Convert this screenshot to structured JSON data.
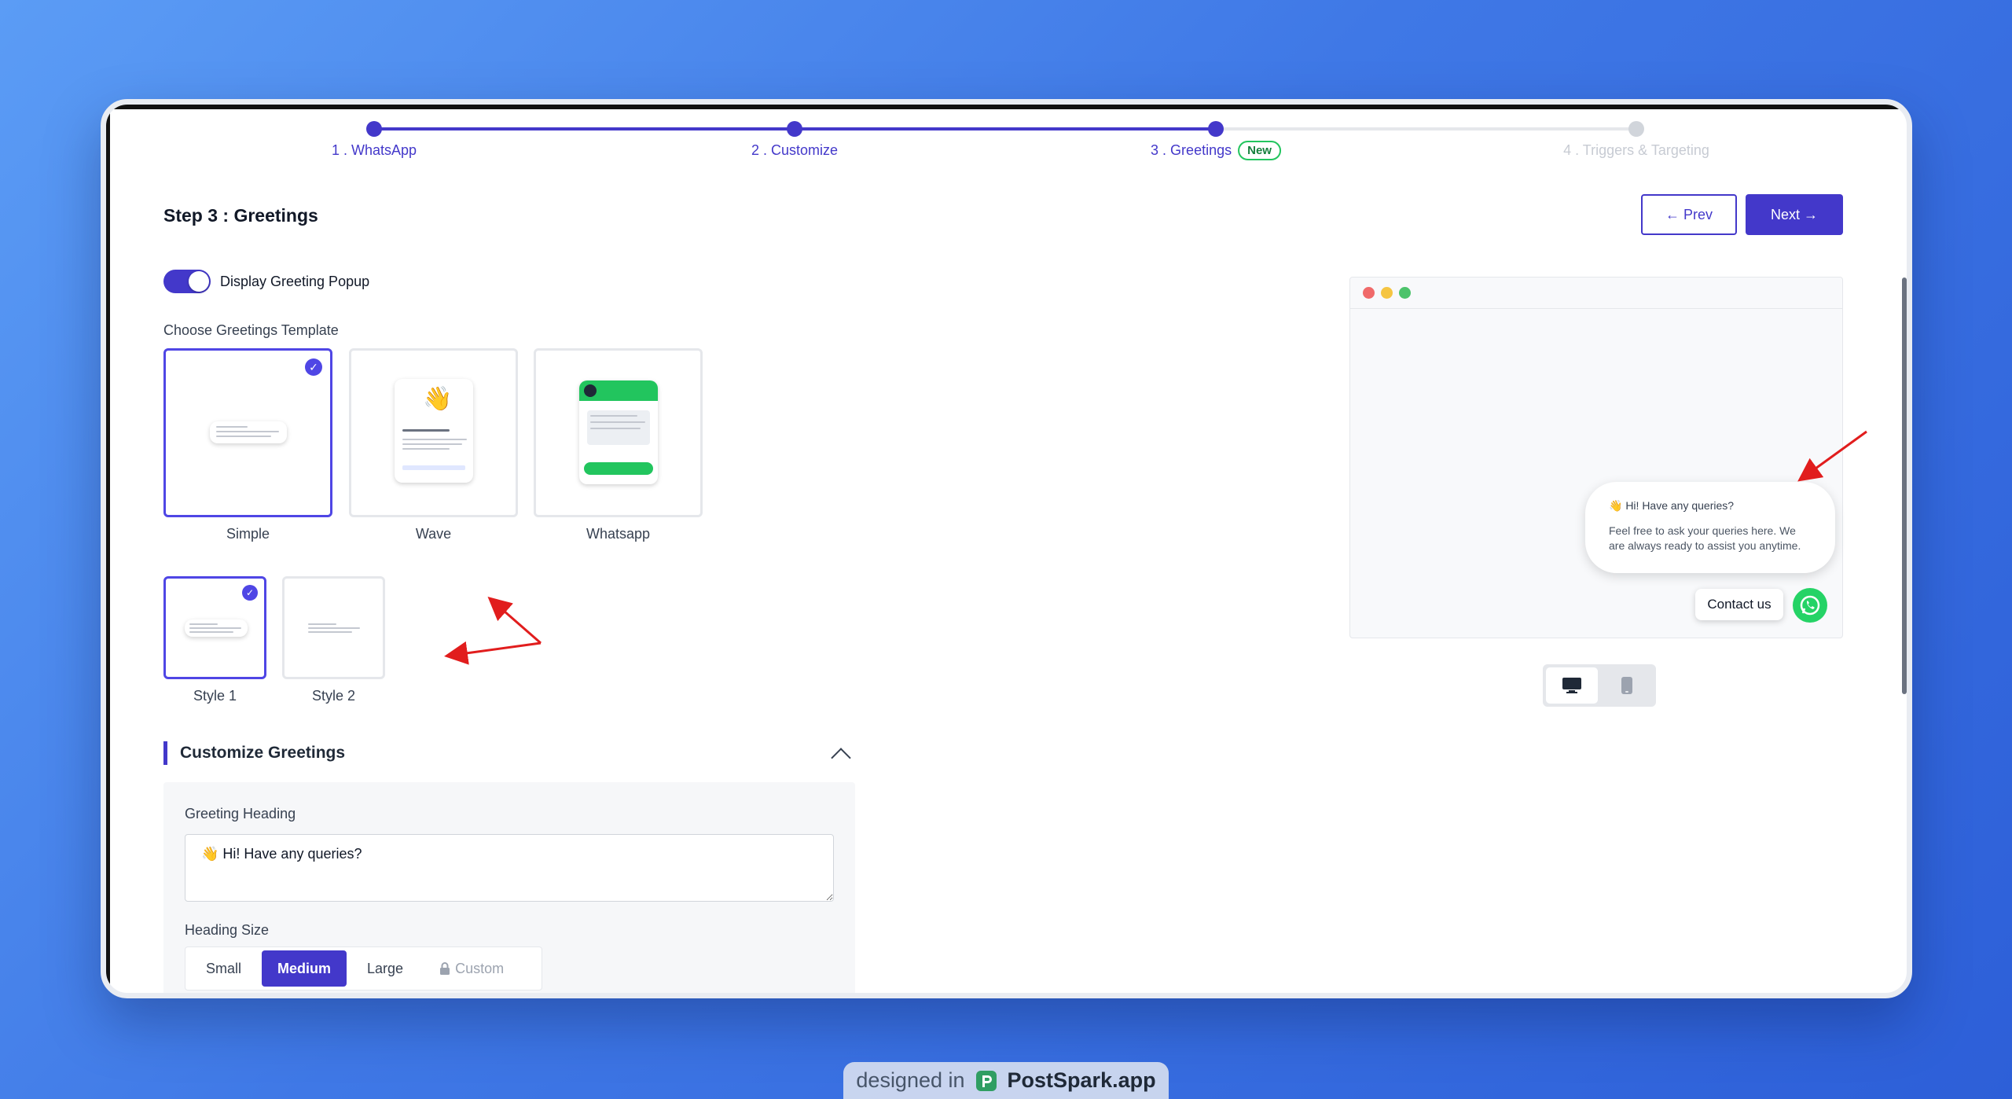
{
  "stepper": {
    "steps": [
      {
        "label": "1 . WhatsApp",
        "state": "done"
      },
      {
        "label": "2 . Customize",
        "state": "done"
      },
      {
        "label": "3 . Greetings",
        "state": "current",
        "badge": "New"
      },
      {
        "label": "4 . Triggers & Targeting",
        "state": "todo"
      }
    ]
  },
  "header": {
    "title": "Step 3 : Greetings",
    "prev_label": "← Prev",
    "next_label": "Next →"
  },
  "toggle": {
    "label": "Display Greeting Popup",
    "on": true
  },
  "templates": {
    "label": "Choose Greetings Template",
    "items": [
      {
        "name": "Simple",
        "selected": true
      },
      {
        "name": "Wave",
        "selected": false
      },
      {
        "name": "Whatsapp",
        "selected": false
      }
    ]
  },
  "styles": {
    "items": [
      {
        "name": "Style 1",
        "selected": true
      },
      {
        "name": "Style 2",
        "selected": false
      }
    ]
  },
  "customize": {
    "title": "Customize Greetings",
    "heading_label": "Greeting Heading",
    "heading_value": "👋 Hi! Have any queries?",
    "size_label": "Heading Size",
    "sizes": [
      "Small",
      "Medium",
      "Large",
      "Custom"
    ],
    "active_size": "Medium"
  },
  "preview": {
    "greet_title": "👋 Hi! Have any queries?",
    "greet_text": "Feel free to ask your queries here. We are always ready to assist you anytime.",
    "contact_label": "Contact us"
  },
  "colors": {
    "accent": "#4338ca",
    "whatsapp": "#25d366"
  },
  "watermark": {
    "prefix": "designed in",
    "brand": "PostSpark.app"
  }
}
